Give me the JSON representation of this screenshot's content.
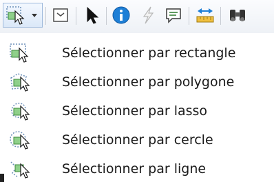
{
  "toolbar": {
    "buttons": [
      {
        "name": "select-tool-dropdown",
        "icon": "select-rectangle-icon",
        "has_dropdown": true
      },
      {
        "name": "select-frame",
        "icon": "frame-icon"
      },
      {
        "name": "pointer",
        "icon": "arrow-pointer-icon"
      },
      {
        "name": "identify",
        "icon": "info-icon"
      },
      {
        "name": "hyperlink",
        "icon": "lightning-icon"
      },
      {
        "name": "html-popup",
        "icon": "speech-bubble-icon"
      },
      {
        "name": "measure",
        "icon": "measure-icon"
      },
      {
        "name": "find",
        "icon": "binoculars-icon"
      }
    ]
  },
  "menu": {
    "items": [
      {
        "label": "Sélectionner par rectangle",
        "icon": "select-rectangle-icon"
      },
      {
        "label": "Sélectionner par polygone",
        "icon": "select-polygon-icon"
      },
      {
        "label": "Sélectionner par lasso",
        "icon": "select-lasso-icon"
      },
      {
        "label": "Sélectionner par cercle",
        "icon": "select-circle-icon"
      },
      {
        "label": "Sélectionner par ligne",
        "icon": "select-line-icon"
      }
    ]
  },
  "colors": {
    "accent_blue": "#1e7fd6",
    "accent_green": "#4aa34a",
    "toolbar_bg": "#eef1f6"
  }
}
